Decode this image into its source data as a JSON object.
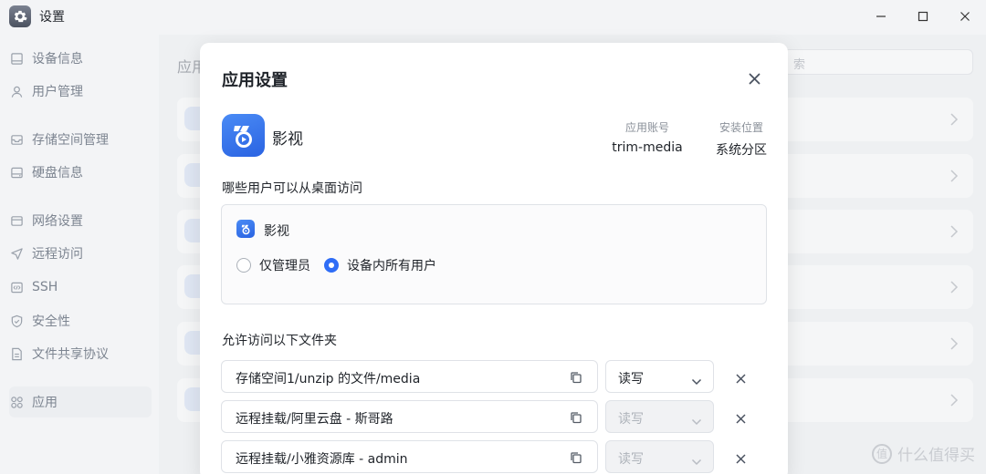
{
  "window": {
    "title": "设置",
    "app_icon": "gear-icon",
    "controls": [
      "minimize-icon",
      "maximize-icon",
      "close-icon"
    ]
  },
  "sidebar": {
    "items": [
      {
        "label": "设备信息",
        "icon": "device-icon"
      },
      {
        "label": "用户管理",
        "icon": "user-icon"
      },
      {
        "label": "存储空间管理",
        "icon": "storage-icon"
      },
      {
        "label": "硬盘信息",
        "icon": "disk-icon"
      },
      {
        "label": "网络设置",
        "icon": "network-icon"
      },
      {
        "label": "远程访问",
        "icon": "send-icon"
      },
      {
        "label": "SSH",
        "icon": "code-icon"
      },
      {
        "label": "安全性",
        "icon": "shield-icon"
      },
      {
        "label": "文件共享协议",
        "icon": "file-icon"
      },
      {
        "label": "应用",
        "icon": "apps-icon",
        "active": true
      }
    ]
  },
  "background": {
    "title": "应用",
    "search_placeholder": "索"
  },
  "modal": {
    "title": "应用设置",
    "app": {
      "name": "影视",
      "icon": "video-app-icon",
      "account_label": "应用账号",
      "account_value": "trim-media",
      "location_label": "安装位置",
      "location_value": "系统分区"
    },
    "desktop_access": {
      "label": "哪些用户可以从桌面访问",
      "app_name": "影视",
      "options": [
        {
          "label": "仅管理员",
          "checked": false
        },
        {
          "label": "设备内所有用户",
          "checked": true
        }
      ]
    },
    "folders": {
      "label": "允许访问以下文件夹",
      "rows": [
        {
          "path": "存储空间1/unzip 的文件/media",
          "permission": "读写",
          "disabled": false
        },
        {
          "path": "远程挂载/阿里云盘 - 斯哥路",
          "permission": "读写",
          "disabled": true
        },
        {
          "path": "远程挂载/小雅资源库 - admin",
          "permission": "读写",
          "disabled": true
        }
      ]
    }
  },
  "watermark": {
    "text": "什么值得买",
    "icon_text": "值"
  },
  "colors": {
    "accent": "#2f6df6",
    "app_icon_blue": "#2a63e2"
  }
}
